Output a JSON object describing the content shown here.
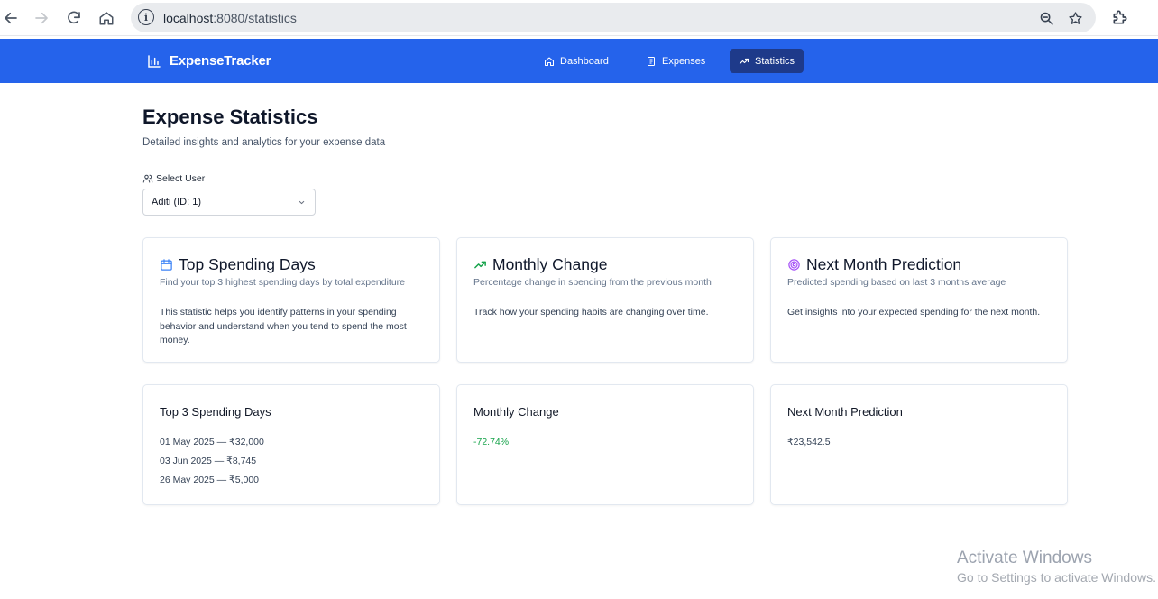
{
  "browser": {
    "url_host": "localhost",
    "url_path": ":8080/statistics",
    "site_info_glyph": "i",
    "icons": [
      "back-icon",
      "forward-icon",
      "reload-icon",
      "home-icon",
      "zoom-icon",
      "bookmark-star-icon",
      "extensions-icon"
    ]
  },
  "header": {
    "brand": "ExpenseTracker",
    "nav": [
      {
        "label": "Dashboard",
        "icon": "home-icon"
      },
      {
        "label": "Expenses",
        "icon": "receipt-icon"
      },
      {
        "label": "Statistics",
        "icon": "trending-up-icon",
        "active": true
      }
    ]
  },
  "page": {
    "title": "Expense Statistics",
    "subtitle": "Detailed insights and analytics for your expense data",
    "select_label": "Select User",
    "selected_user": "Aditi (ID: 1)"
  },
  "info_cards": [
    {
      "title": "Top Spending Days",
      "icon": "calendar-icon",
      "description": "Find your top 3 highest spending days by total expenditure",
      "body": "This statistic helps you identify patterns in your spending behavior and understand when you tend to spend the most money."
    },
    {
      "title": "Monthly Change",
      "icon": "trending-up-icon",
      "description": "Percentage change in spending from the previous month",
      "body": "Track how your spending habits are changing over time."
    },
    {
      "title": "Next Month Prediction",
      "icon": "target-icon",
      "description": "Predicted spending based on last 3 months average",
      "body": "Get insights into your expected spending for the next month."
    }
  ],
  "result_cards": {
    "top_days": {
      "title": "Top 3 Spending Days",
      "items": [
        "01 May 2025 — ₹32,000",
        "03 Jun 2025 — ₹8,745",
        "26 May 2025 — ₹5,000"
      ]
    },
    "monthly_change": {
      "title": "Monthly Change",
      "value": "-72.74%"
    },
    "prediction": {
      "title": "Next Month Prediction",
      "value": "₹23,542.5"
    }
  },
  "watermark": {
    "title": "Activate Windows",
    "subtitle": "Go to Settings to activate Windows."
  },
  "colors": {
    "header_bg": "#2563eb",
    "nav_active_bg": "#1e3a8a",
    "positive_green": "#16a34a",
    "calendar_blue": "#3b82f6",
    "target_purple": "#a855f7"
  }
}
